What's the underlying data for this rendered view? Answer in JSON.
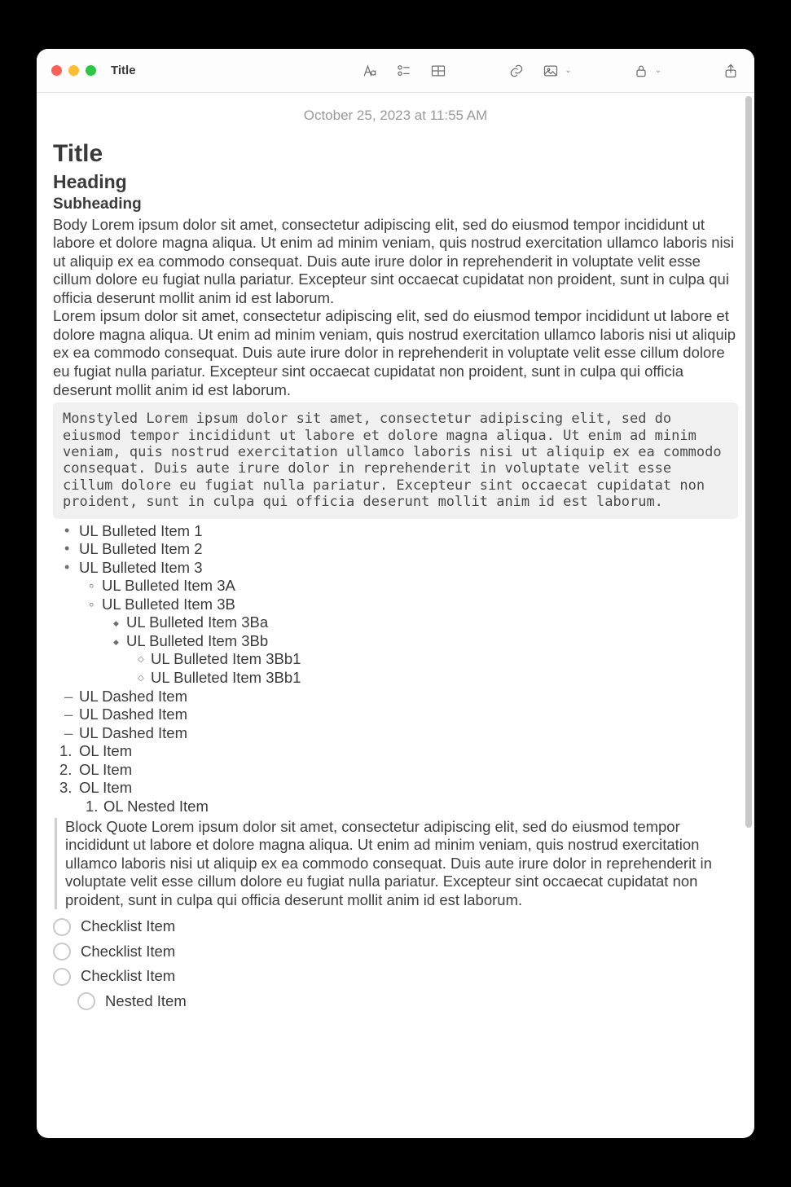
{
  "window": {
    "title": "Title"
  },
  "timestamp": "October 25, 2023 at 11:55 AM",
  "note": {
    "title": "Title",
    "heading": "Heading",
    "subheading": "Subheading",
    "body1": "Body Lorem ipsum dolor sit amet, consectetur adipiscing elit, sed do eiusmod tempor incididunt ut labore et dolore magna aliqua. Ut enim ad minim veniam, quis nostrud exercitation ullamco laboris nisi ut aliquip ex ea commodo consequat. Duis aute irure dolor in reprehenderit in voluptate velit esse cillum dolore eu fugiat nulla pariatur. Excepteur sint occaecat cupidatat non proident, sunt in culpa qui officia deserunt mollit anim id est laborum.",
    "body2": "Lorem ipsum dolor sit amet, consectetur adipiscing elit, sed do eiusmod tempor incididunt ut labore et dolore magna aliqua. Ut enim ad minim veniam, quis nostrud exercitation ullamco laboris nisi ut aliquip ex ea commodo consequat. Duis aute irure dolor in reprehenderit in voluptate velit esse cillum dolore eu fugiat nulla pariatur. Excepteur sint occaecat cupidatat non proident, sunt in culpa qui officia deserunt mollit anim id est laborum.",
    "mono": "Monstyled Lorem ipsum dolor sit amet, consectetur adipiscing elit, sed do eiusmod tempor incididunt ut labore et dolore magna aliqua. Ut enim ad minim veniam, quis nostrud exercitation ullamco laboris nisi ut aliquip ex ea commodo consequat. Duis aute irure dolor in reprehenderit in voluptate velit esse cillum dolore eu fugiat nulla pariatur. Excepteur sint occaecat cupidatat non proident, sunt in culpa qui officia deserunt mollit anim id est laborum.",
    "bullets": {
      "i1": "UL Bulleted Item 1",
      "i2": "UL Bulleted Item 2",
      "i3": "UL Bulleted Item 3",
      "i3a": "UL Bulleted Item 3A",
      "i3b": "UL Bulleted Item 3B",
      "i3ba": "UL Bulleted Item 3Ba",
      "i3bb": "UL Bulleted Item 3Bb",
      "i3bb1": "UL Bulleted Item 3Bb1",
      "i3bb2": "UL Bulleted Item 3Bb1"
    },
    "dashes": {
      "d1": "UL Dashed Item",
      "d2": "UL Dashed Item",
      "d3": "UL Dashed Item"
    },
    "ordered": {
      "o1": "OL Item",
      "o2": "OL Item",
      "o3": "OL Item",
      "o3a": "OL Nested Item"
    },
    "blockquote": "Block Quote Lorem ipsum dolor sit amet, consectetur adipiscing elit, sed do eiusmod tempor incididunt ut labore et dolore magna aliqua. Ut enim ad minim veniam, quis nostrud exercitation ullamco laboris nisi ut aliquip ex ea commodo consequat. Duis aute irure dolor in reprehenderit in voluptate velit esse cillum dolore eu fugiat nulla pariatur. Excepteur sint occaecat cupidatat non proident, sunt in culpa qui officia deserunt mollit anim id est laborum.",
    "checklist": {
      "c1": "Checklist Item",
      "c2": "Checklist Item",
      "c3": "Checklist Item",
      "c3a": "Nested Item"
    }
  }
}
